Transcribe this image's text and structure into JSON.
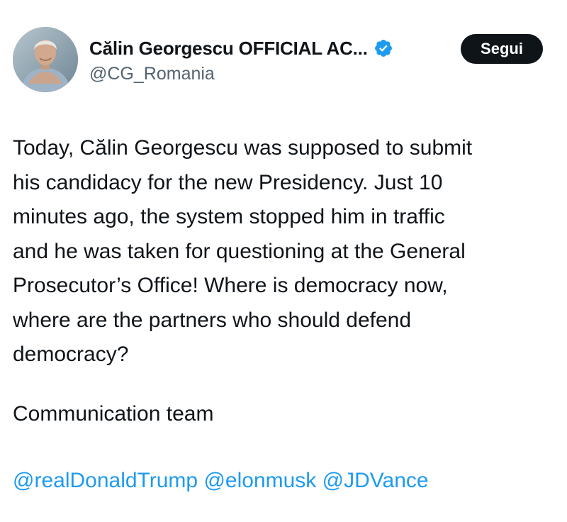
{
  "author": {
    "display_name": "Călin Georgescu OFFICIAL AC...",
    "handle": "@CG_Romania",
    "verified": true,
    "avatar_icon": "profile-photo"
  },
  "follow_button": {
    "label": "Segui"
  },
  "post": {
    "text": "Today, Călin Georgescu was supposed to submit\nhis candidacy for the new Presidency. Just 10\nminutes ago, the system stopped him in traffic\nand he was taken for questioning at the General\nProsecutor’s Office! Where is democracy now,\nwhere are the partners who should defend\ndemocracy?",
    "signature": "Communication team",
    "mentions": [
      "@realDonaldTrump",
      "@elonmusk",
      "@JDVance"
    ]
  },
  "colors": {
    "text": "#0f1419",
    "secondary": "#536471",
    "link": "#1d9bf0",
    "verified_badge": "#1d9bf0",
    "button_bg": "#0f1419",
    "button_text": "#ffffff"
  }
}
